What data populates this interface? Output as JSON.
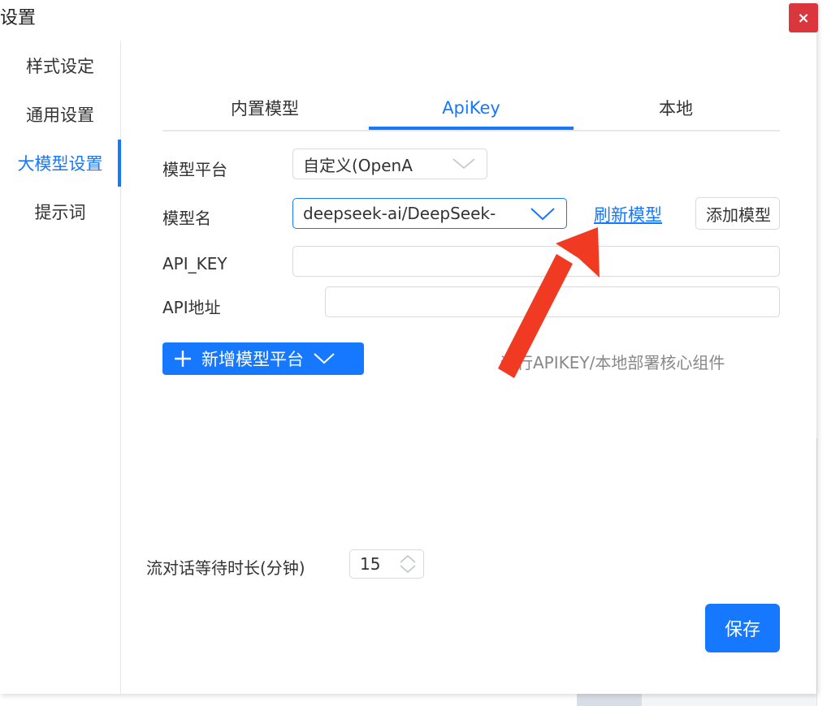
{
  "window": {
    "title": "设置",
    "close_label": "×"
  },
  "sidebar": {
    "items": [
      {
        "label": "样式设定"
      },
      {
        "label": "通用设置"
      },
      {
        "label": "大模型设置"
      },
      {
        "label": "提示词"
      }
    ],
    "active_index": 2
  },
  "tabs": [
    {
      "label": "内置模型"
    },
    {
      "label": "ApiKey"
    },
    {
      "label": "本地"
    }
  ],
  "active_tab": 1,
  "form": {
    "platform_label": "模型平台",
    "platform_value": "自定义(OpenA",
    "model_name_label": "模型名",
    "model_name_value": "deepseek-ai/DeepSeek-",
    "refresh_model_link": "刷新模型",
    "add_model_button": "添加模型",
    "api_key_label": "API_KEY",
    "api_key_value": "",
    "api_url_label": "API地址",
    "api_url_value": "",
    "add_platform_button": "新增模型平台",
    "hint_text": "运行APIKEY/本地部署核心组件",
    "stream_wait_label": "流对话等待时长(分钟)",
    "stream_wait_value": "15",
    "save_button": "保存"
  },
  "colors": {
    "accent": "#1677ff",
    "close": "#d9363e",
    "annotation_arrow": "#f03a22"
  }
}
